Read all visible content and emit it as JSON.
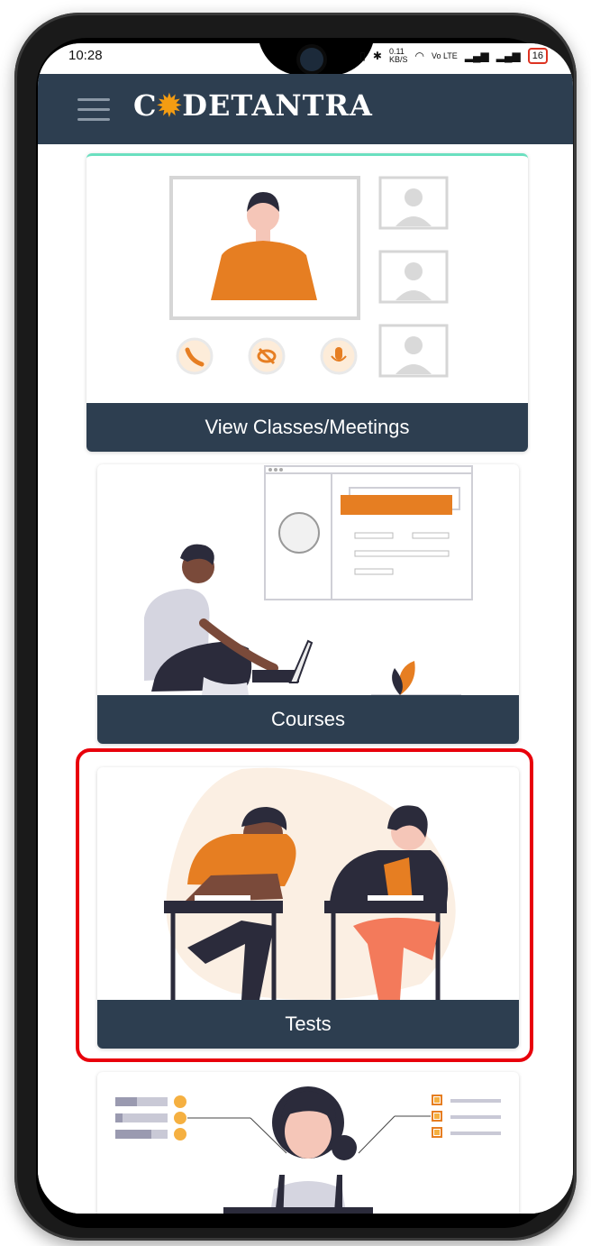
{
  "status": {
    "time": "10:28",
    "net_speed_top": "0.11",
    "net_speed_unit": "KB/S",
    "volte": "Vo LTE",
    "battery": "16"
  },
  "app": {
    "logo_c": "C",
    "logo_rest": "DETANTRA"
  },
  "cards": [
    {
      "label": "View Classes/Meetings"
    },
    {
      "label": "Courses"
    },
    {
      "label": "Tests"
    }
  ],
  "colors": {
    "appbar": "#2d3e50",
    "accent_orange": "#e67e22",
    "highlight": "#e8000b"
  }
}
